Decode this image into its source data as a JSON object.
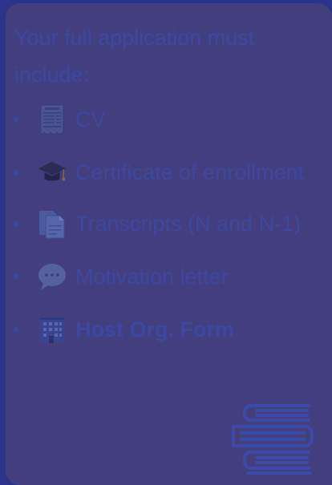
{
  "card": {
    "intro": "Your full application must include:",
    "requirements": [
      {
        "label": "CV",
        "icon": "receipt-icon",
        "bold": false
      },
      {
        "label": "Certificate of enrollment",
        "icon": "graduation-cap-icon",
        "bold": false
      },
      {
        "label": "Transcripts (N and N-1)",
        "icon": "documents-icon",
        "bold": false
      },
      {
        "label": "Motivation letter",
        "icon": "speech-bubble-icon",
        "bold": false
      },
      {
        "label": "Host Org. Form",
        "icon": "office-building-icon",
        "bold": true
      }
    ],
    "decoration_icon": "books-stack-icon"
  },
  "colors": {
    "background": "#2b338a",
    "card": "#433f7e",
    "text": "#3c48a0"
  }
}
